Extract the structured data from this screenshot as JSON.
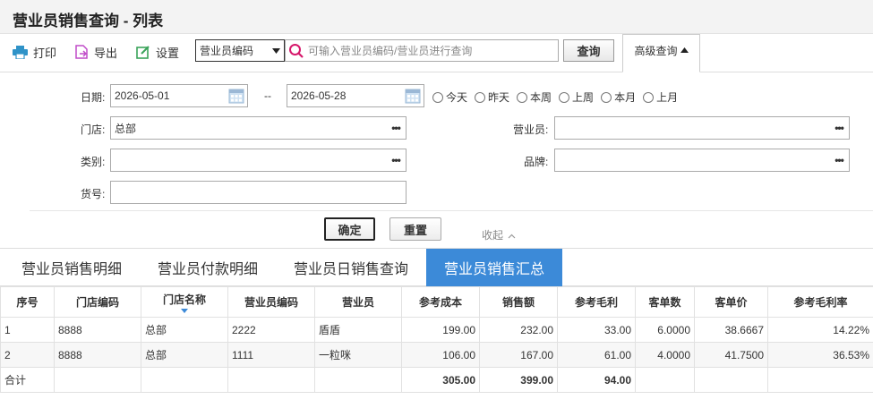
{
  "page": {
    "title": "营业员销售查询 - 列表"
  },
  "toolbar": {
    "print_label": "打印",
    "export_label": "导出",
    "settings_label": "设置",
    "select_value": "营业员编码",
    "search_placeholder": "可输入营业员编码/营业员进行查询",
    "query_label": "查询",
    "advanced_label": "高级查询"
  },
  "form": {
    "date_label": "日期:",
    "date_from": "2026-05-01",
    "date_sep": "--",
    "date_to": "2026-05-28",
    "radios": [
      "今天",
      "昨天",
      "本周",
      "上周",
      "本月",
      "上月"
    ],
    "store_label": "门店:",
    "store_value": "总部",
    "salesperson_label": "营业员:",
    "salesperson_value": "",
    "category_label": "类别:",
    "category_value": "",
    "brand_label": "品牌:",
    "brand_value": "",
    "item_label": "货号:",
    "item_value": "",
    "confirm_label": "确定",
    "reset_label": "重置",
    "collapse_label": "收起"
  },
  "tabs": [
    "营业员销售明细",
    "营业员付款明细",
    "营业员日销售查询",
    "营业员销售汇总"
  ],
  "table": {
    "headers": [
      "序号",
      "门店编码",
      "门店名称",
      "营业员编码",
      "营业员",
      "参考成本",
      "销售额",
      "参考毛利",
      "客单数",
      "客单价",
      "参考毛利率"
    ],
    "rows": [
      [
        "1",
        "8888",
        "总部",
        "2222",
        "盾盾",
        "199.00",
        "232.00",
        "33.00",
        "6.0000",
        "38.6667",
        "14.22%"
      ],
      [
        "2",
        "8888",
        "总部",
        "1111",
        "一粒咪",
        "106.00",
        "167.00",
        "61.00",
        "4.0000",
        "41.7500",
        "36.53%"
      ]
    ],
    "total": [
      "合计",
      "",
      "",
      "",
      "",
      "305.00",
      "399.00",
      "94.00",
      "",
      "",
      ""
    ]
  },
  "colors": {
    "accent": "#3c8ad8",
    "print_icon": "#2f93c8",
    "export_icon": "#c04cc9",
    "settings_icon": "#3aa35a",
    "search_icon": "#d6186b"
  }
}
